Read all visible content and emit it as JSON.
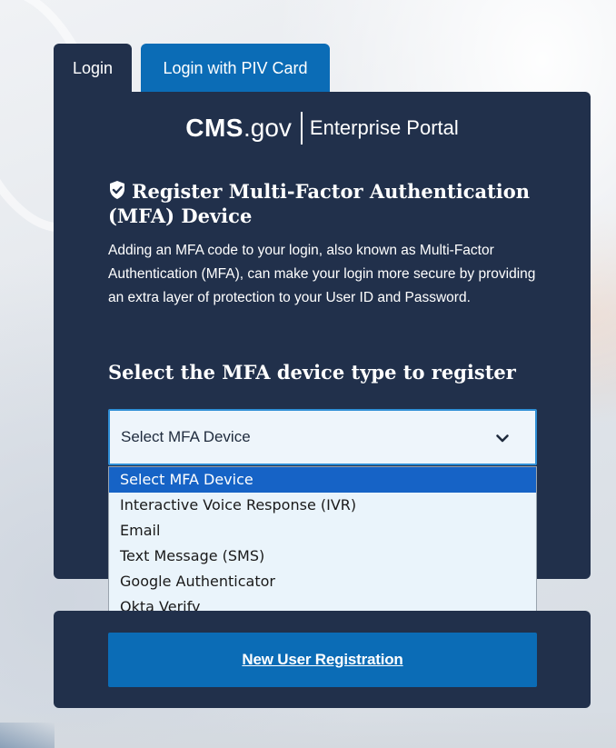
{
  "tabs": {
    "login": "Login",
    "piv": "Login with PIV Card"
  },
  "logo": {
    "cms": "CMS",
    "gov": ".gov",
    "enterprise": "Enterprise Portal"
  },
  "mfa": {
    "title": "Register Multi-Factor Authentication (MFA) Device",
    "description": "Adding an MFA code to your login, also known as Multi-Factor Authentication (MFA), can make your login more secure by providing an extra layer of protection to your User ID and Password.",
    "select_heading": "Select the MFA device type to register",
    "select_value": "Select MFA Device",
    "options": [
      "Select MFA Device",
      "Interactive Voice Response (IVR)",
      "Email",
      "Text Message (SMS)",
      "Google Authenticator",
      "Okta Verify"
    ]
  },
  "registration": {
    "new_user_label": "New User Registration"
  },
  "colors": {
    "card_bg": "#21304b",
    "accent_blue": "#0b6cb6",
    "selected_option": "#1663c6"
  }
}
